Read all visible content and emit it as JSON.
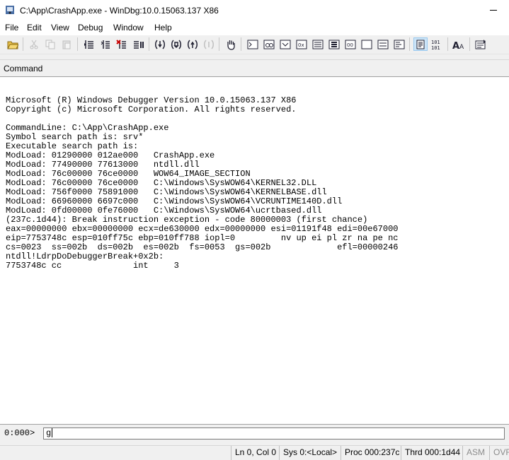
{
  "window": {
    "title": "C:\\App\\CrashApp.exe - WinDbg:10.0.15063.137 X86"
  },
  "menu": [
    "File",
    "Edit",
    "View",
    "Debug",
    "Window",
    "Help"
  ],
  "toolbar": {
    "zoom_button_label": "101\n101"
  },
  "command_window": {
    "title": "Command",
    "output_lines": [
      "",
      "Microsoft (R) Windows Debugger Version 10.0.15063.137 X86",
      "Copyright (c) Microsoft Corporation. All rights reserved.",
      "",
      "CommandLine: C:\\App\\CrashApp.exe",
      "Symbol search path is: srv*",
      "Executable search path is:",
      "ModLoad: 01290000 012ae000   CrashApp.exe",
      "ModLoad: 77490000 77613000   ntdll.dll",
      "ModLoad: 76c00000 76ce0000   WOW64_IMAGE_SECTION",
      "ModLoad: 76c00000 76ce0000   C:\\Windows\\SysWOW64\\KERNEL32.DLL",
      "ModLoad: 756f0000 75891000   C:\\Windows\\SysWOW64\\KERNELBASE.dll",
      "ModLoad: 66960000 6697c000   C:\\Windows\\SysWOW64\\VCRUNTIME140D.dll",
      "ModLoad: 0fd00000 0fe76000   C:\\Windows\\SysWOW64\\ucrtbased.dll",
      "(237c.1d44): Break instruction exception - code 80000003 (first chance)",
      "eax=00000000 ebx=00000000 ecx=de630000 edx=00000000 esi=01191f48 edi=00e67000",
      "eip=7753748c esp=010ff75c ebp=010ff788 iopl=0         nv up ei pl zr na pe nc",
      "cs=0023  ss=002b  ds=002b  es=002b  fs=0053  gs=002b             efl=00000246",
      "ntdll!LdrpDoDebuggerBreak+0x2b:",
      "7753748c cc              int     3"
    ],
    "prompt": "0:000>",
    "input_value": "g"
  },
  "status_bar": {
    "line_col": "Ln 0, Col 0",
    "sys": "Sys 0:<Local>",
    "proc": "Proc 000:237c",
    "thrd": "Thrd 000:1d44",
    "asm": "ASM",
    "ovr": "OVR"
  }
}
